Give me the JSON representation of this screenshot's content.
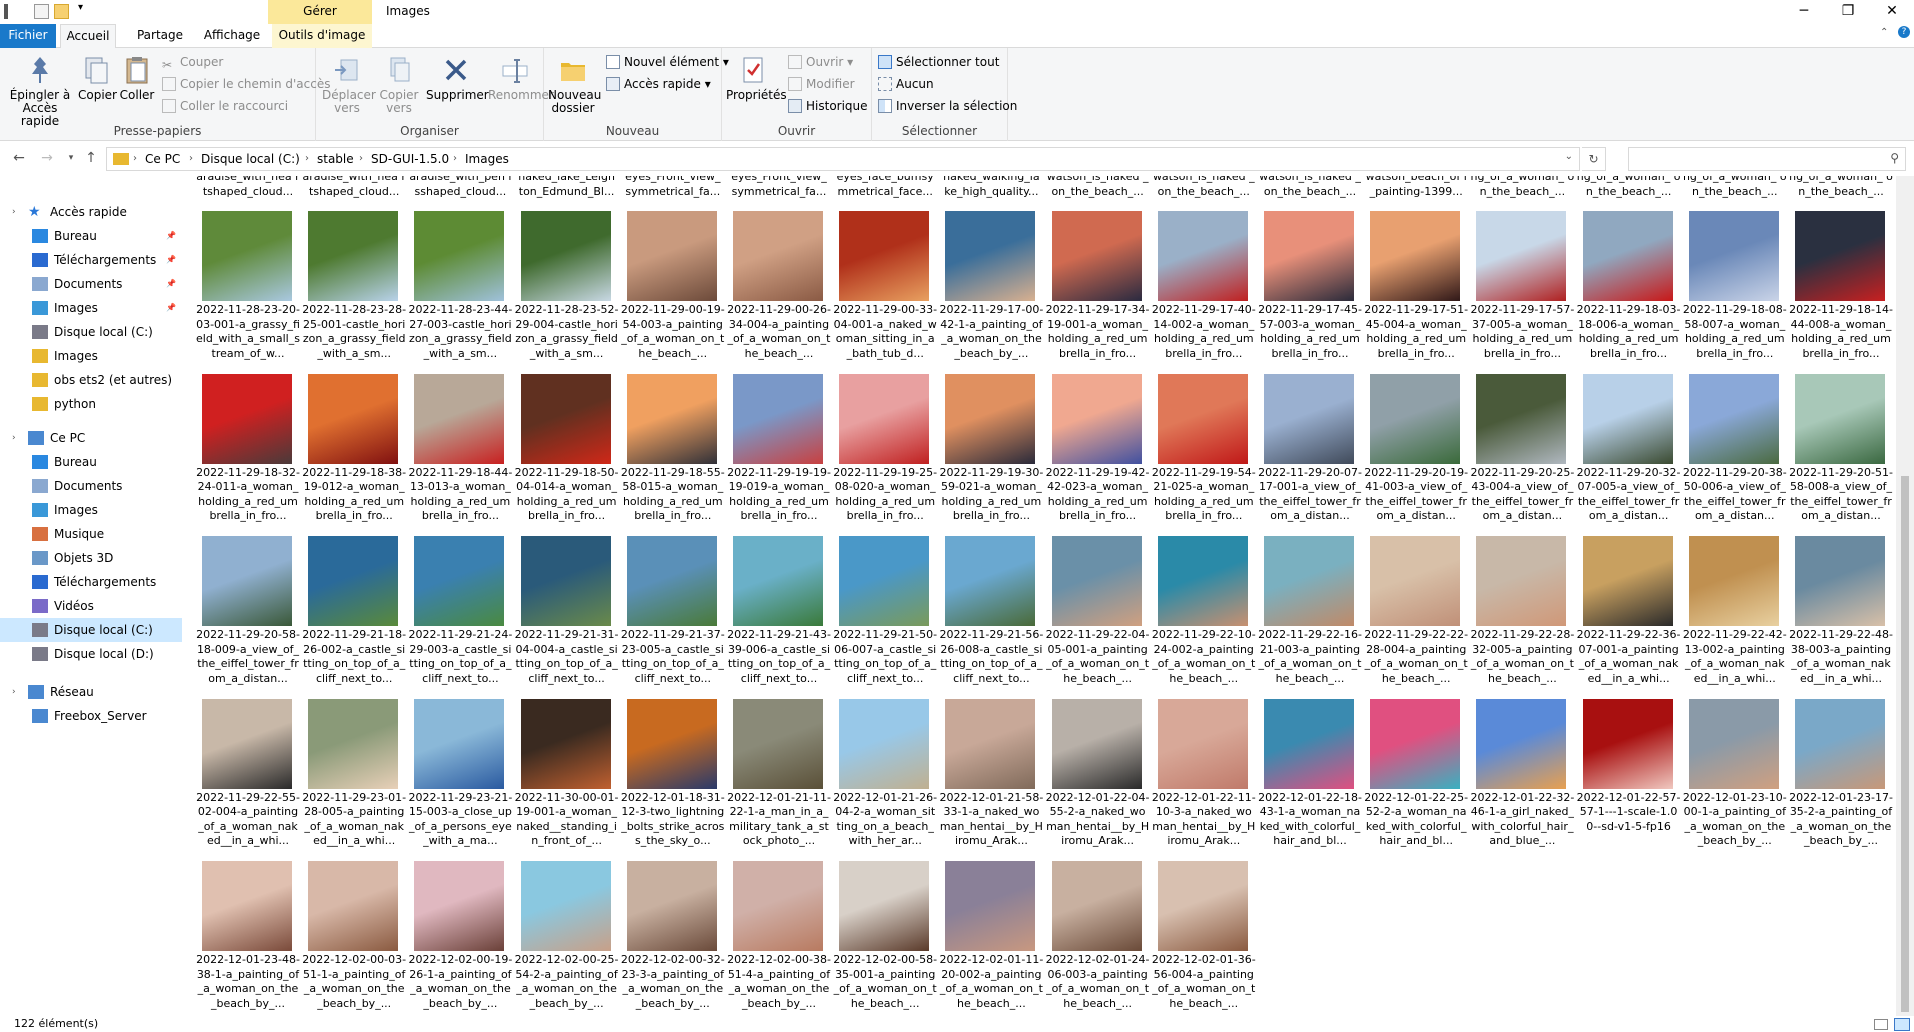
{
  "window": {
    "contextual_tab": "Gérer",
    "title": "Images"
  },
  "tabs": {
    "file": "Fichier",
    "home": "Accueil",
    "share": "Partage",
    "view": "Affichage",
    "image_tools": "Outils d'image"
  },
  "ribbon": {
    "clipboard": {
      "label": "Presse-papiers",
      "pin": "Épingler à Accès rapide",
      "copy": "Copier",
      "paste": "Coller",
      "cut": "Couper",
      "copy_path": "Copier le chemin d'accès",
      "paste_shortcut": "Coller le raccourci"
    },
    "organize": {
      "label": "Organiser",
      "move": "Déplacer vers",
      "copyto": "Copier vers",
      "delete": "Supprimer",
      "rename": "Renommer"
    },
    "new": {
      "label": "Nouveau",
      "new_folder": "Nouveau dossier",
      "new_item": "Nouvel élément",
      "quick_access": "Accès rapide"
    },
    "open": {
      "label": "Ouvrir",
      "properties": "Propriétés",
      "open": "Ouvrir",
      "edit": "Modifier",
      "history": "Historique"
    },
    "select": {
      "label": "Sélectionner",
      "select_all": "Sélectionner tout",
      "none": "Aucun",
      "invert": "Inverser la sélection"
    }
  },
  "breadcrumb": [
    "Ce PC",
    "Disque local (C:)",
    "stable",
    "SD-GUI-1.5.0",
    "Images"
  ],
  "nav": {
    "quick_access": "Accès rapide",
    "quick_items": [
      "Bureau",
      "Téléchargements",
      "Documents",
      "Images",
      "Disque local (C:)",
      "Images",
      "obs ets2 (et autres)",
      "python"
    ],
    "this_pc": "Ce PC",
    "pc_items": [
      "Bureau",
      "Documents",
      "Images",
      "Musique",
      "Objets 3D",
      "Téléchargements",
      "Vidéos",
      "Disque local (C:)",
      "Disque local (D:)"
    ],
    "network": "Réseau",
    "network_items": [
      "Freebox_Server"
    ]
  },
  "top_partial": [
    "aradise_with_nea rtshaped_cloud...",
    "aradise_with_nea rtshaped_cloud...",
    "aradise_with_pen isshaped_cloud...",
    "naked_lake_Leigh ton_Edmund_Bl...",
    "eyes_Front_view_ symmetrical_fa...",
    "eyes_Front_view_ symmetrical_fa...",
    "eyes_face_bumsy mmetrical_face...",
    "naked_walking_la ke_high_quality...",
    "watson_is_naked _on_the_beach_...",
    "watson_is_naked _on_the_beach_...",
    "watson_is_naked _on_the_beach_...",
    "watson_beach_of l_painting-1399...",
    "ng_of_a_woman_ on_the_beach_...",
    "ng_of_a_woman_ on_the_beach_...",
    "ng_of_a_woman_ on_the_beach_...",
    "ng_of_a_woman_ on_the_beach_..."
  ],
  "files": [
    [
      "2022-11-28-23-20-03-001-a_grassy_field_with_a_small_stream_of_w...",
      "2022-11-28-23-28-25-001-castle_horizon_a_grassy_field_with_a_sm...",
      "2022-11-28-23-44-27-003-castle_horizon_a_grassy_field_with_a_sm...",
      "2022-11-28-23-52-29-004-castle_horizon_a_grassy_field_with_a_sm...",
      "2022-11-29-00-19-54-003-a_painting_of_a_woman_on_the_beach_...",
      "2022-11-29-00-26-34-004-a_painting_of_a_woman_on_the_beach_...",
      "2022-11-29-00-33-04-001-a_naked_woman_sitting_in_a_bath_tub_d...",
      "2022-11-29-17-00-42-1-a_painting_of_a_woman_on_the_beach_by_...",
      "2022-11-29-17-34-19-001-a_woman_holding_a_red_umbrella_in_fro...",
      "2022-11-29-17-40-14-002-a_woman_holding_a_red_umbrella_in_fro...",
      "2022-11-29-17-45-57-003-a_woman_holding_a_red_umbrella_in_fro...",
      "2022-11-29-17-51-45-004-a_woman_holding_a_red_umbrella_in_fro...",
      "2022-11-29-17-57-37-005-a_woman_holding_a_red_umbrella_in_fro...",
      "2022-11-29-18-03-18-006-a_woman_holding_a_red_umbrella_in_fro...",
      "2022-11-29-18-08-58-007-a_woman_holding_a_red_umbrella_in_fro...",
      "2022-11-29-18-14-44-008-a_woman_holding_a_red_umbrella_in_fro..."
    ],
    [
      "2022-11-29-18-32-24-011-a_woman_holding_a_red_umbrella_in_fro...",
      "2022-11-29-18-38-19-012-a_woman_holding_a_red_umbrella_in_fro...",
      "2022-11-29-18-44-13-013-a_woman_holding_a_red_umbrella_in_fro...",
      "2022-11-29-18-50-04-014-a_woman_holding_a_red_umbrella_in_fro...",
      "2022-11-29-18-55-58-015-a_woman_holding_a_red_umbrella_in_fro...",
      "2022-11-29-19-19-19-019-a_woman_holding_a_red_umbrella_in_fro...",
      "2022-11-29-19-25-08-020-a_woman_holding_a_red_umbrella_in_fro...",
      "2022-11-29-19-30-59-021-a_woman_holding_a_red_umbrella_in_fro...",
      "2022-11-29-19-42-42-023-a_woman_holding_a_red_umbrella_in_fro...",
      "2022-11-29-19-54-21-025-a_woman_holding_a_red_umbrella_in_fro...",
      "2022-11-29-20-07-17-001-a_view_of_the_eiffel_tower_from_a_distan...",
      "2022-11-29-20-19-41-003-a_view_of_the_eiffel_tower_from_a_distan...",
      "2022-11-29-20-25-43-004-a_view_of_the_eiffel_tower_from_a_distan...",
      "2022-11-29-20-32-07-005-a_view_of_the_eiffel_tower_from_a_distan...",
      "2022-11-29-20-38-50-006-a_view_of_the_eiffel_tower_from_a_distan...",
      "2022-11-29-20-51-58-008-a_view_of_the_eiffel_tower_from_a_distan..."
    ],
    [
      "2022-11-29-20-58-18-009-a_view_of_the_eiffel_tower_from_a_distan...",
      "2022-11-29-21-18-26-002-a_castle_sitting_on_top_of_a_cliff_next_to...",
      "2022-11-29-21-24-29-003-a_castle_sitting_on_top_of_a_cliff_next_to...",
      "2022-11-29-21-31-04-004-a_castle_sitting_on_top_of_a_cliff_next_to...",
      "2022-11-29-21-37-23-005-a_castle_sitting_on_top_of_a_cliff_next_to...",
      "2022-11-29-21-43-39-006-a_castle_sitting_on_top_of_a_cliff_next_to...",
      "2022-11-29-21-50-06-007-a_castle_sitting_on_top_of_a_cliff_next_to...",
      "2022-11-29-21-56-26-008-a_castle_sitting_on_top_of_a_cliff_next_to...",
      "2022-11-29-22-04-05-001-a_painting_of_a_woman_on_the_beach_...",
      "2022-11-29-22-10-24-002-a_painting_of_a_woman_on_the_beach_...",
      "2022-11-29-22-16-21-003-a_painting_of_a_woman_on_the_beach_...",
      "2022-11-29-22-22-28-004-a_painting_of_a_woman_on_the_beach_...",
      "2022-11-29-22-28-32-005-a_painting_of_a_woman_on_the_beach_...",
      "2022-11-29-22-36-07-001-a_painting_of_a_woman_naked__in_a_whi...",
      "2022-11-29-22-42-13-002-a_painting_of_a_woman_naked__in_a_whi...",
      "2022-11-29-22-48-38-003-a_painting_of_a_woman_naked__in_a_whi..."
    ],
    [
      "2022-11-29-22-55-02-004-a_painting_of_a_woman_naked__in_a_whi...",
      "2022-11-29-23-01-28-005-a_painting_of_a_woman_naked__in_a_whi...",
      "2022-11-29-23-21-15-003-a_close_up_of_a_persons_eye_with_a_ma...",
      "2022-11-30-00-01-19-001-a_woman_naked__standing_in_front_of_...",
      "2022-12-01-18-31-12-3-two_lightning_bolts_strike_across_the_sky_o...",
      "2022-12-01-21-11-22-1-a_man_in_a_military_tank_a_stock_photo_...",
      "2022-12-01-21-26-04-2-a_woman_sitting_on_a_beach_with_her_ar...",
      "2022-12-01-21-58-33-1-a_naked_woman_hentai__by_Hiromu_Arak...",
      "2022-12-01-22-04-55-2-a_naked_woman_hentai__by_Hiromu_Arak...",
      "2022-12-01-22-11-10-3-a_naked_woman_hentai__by_Hiromu_Arak...",
      "2022-12-01-22-18-43-1-a_woman_naked_with_colorful_hair_and_bl...",
      "2022-12-01-22-25-52-2-a_woman_naked_with_colorful_hair_and_bl...",
      "2022-12-01-22-32-46-1-a_girl_naked_with_colorful_hair_and_blue_...",
      "2022-12-01-22-57-57-1---1-scale-1.00--sd-v1-5-fp16",
      "2022-12-01-23-10-00-1-a_painting_of_a_woman_on_the_beach_by_...",
      "2022-12-01-23-17-35-2-a_painting_of_a_woman_on_the_beach_by_..."
    ],
    [
      "2022-12-01-23-48-38-1-a_painting_of_a_woman_on_the_beach_by_...",
      "2022-12-02-00-03-51-1-a_painting_of_a_woman_on_the_beach_by_...",
      "2022-12-02-00-19-26-1-a_painting_of_a_woman_on_the_beach_by_...",
      "2022-12-02-00-25-54-2-a_painting_of_a_woman_on_the_beach_by_...",
      "2022-12-02-00-32-23-3-a_painting_of_a_woman_on_the_beach_by_...",
      "2022-12-02-00-38-51-4-a_painting_of_a_woman_on_the_beach_by_...",
      "2022-12-02-00-58-35-001-a_painting_of_a_woman_on_the_beach_...",
      "2022-12-02-01-11-20-002-a_painting_of_a_woman_on_the_beach_...",
      "2022-12-02-01-24-06-003-a_painting_of_a_woman_on_the_beach_...",
      "2022-12-02-01-36-56-004-a_painting_of_a_woman_on_the_beach_..."
    ]
  ],
  "thumb_colors": [
    [
      [
        "#5f8a3a",
        "#a9c8e0"
      ],
      [
        "#4e7a30",
        "#b8d2ea"
      ],
      [
        "#5d8b34",
        "#9fc1db"
      ],
      [
        "#3f6a2d",
        "#c8d8e4"
      ],
      [
        "#c99a7e",
        "#6c4a3a"
      ],
      [
        "#d0a084",
        "#8a5a44"
      ],
      [
        "#b0301a",
        "#e8a060"
      ],
      [
        "#3a6e9a",
        "#d8b090"
      ],
      [
        "#d06a50",
        "#2a2a40"
      ],
      [
        "#9ab0c8",
        "#c02020"
      ],
      [
        "#e8907a",
        "#2a2a3a"
      ],
      [
        "#e8a070",
        "#301818"
      ],
      [
        "#c8d8e8",
        "#b02020"
      ],
      [
        "#90a8c0",
        "#c81818"
      ],
      [
        "#6a88b8",
        "#cad4e8"
      ],
      [
        "#2a3040",
        "#c82020"
      ]
    ],
    [
      [
        "#d02020",
        "#4a3a3a"
      ],
      [
        "#e07030",
        "#801010"
      ],
      [
        "#b8a898",
        "#c82020"
      ],
      [
        "#603020",
        "#d02818"
      ],
      [
        "#f0a060",
        "#303038"
      ],
      [
        "#7a98c8",
        "#c84040"
      ],
      [
        "#e8a0a0",
        "#c02020"
      ],
      [
        "#e09060",
        "#2a2a3a"
      ],
      [
        "#f0a890",
        "#4050a0"
      ],
      [
        "#e07858",
        "#c01818"
      ],
      [
        "#9ab0d0",
        "#404a5a"
      ],
      [
        "#90a0a8",
        "#3a6a3a"
      ],
      [
        "#4a5a3a",
        "#b0b8c0"
      ],
      [
        "#b8d0e8",
        "#3a4a30"
      ],
      [
        "#8aa8d8",
        "#4a6a40"
      ],
      [
        "#a8c8b8",
        "#3a6840"
      ]
    ],
    [
      [
        "#90b0d0",
        "#3a5838"
      ],
      [
        "#2a6a9a",
        "#5a8a3a"
      ],
      [
        "#3a80b0",
        "#4a8a40"
      ],
      [
        "#2a5a7a",
        "#6a8a4a"
      ],
      [
        "#5a90b8",
        "#4a7a38"
      ],
      [
        "#6ab0c8",
        "#3a7a3a"
      ],
      [
        "#4a98c8",
        "#7a9a5a"
      ],
      [
        "#6aa8d0",
        "#4a6a38"
      ],
      [
        "#6a90a8",
        "#d0a080"
      ],
      [
        "#2a8aa8",
        "#c89070"
      ],
      [
        "#7ab0c0",
        "#c08a68"
      ],
      [
        "#d8c0a8",
        "#c09078"
      ],
      [
        "#c8b8a8",
        "#d09878"
      ],
      [
        "#c8a060",
        "#2a2a2a"
      ],
      [
        "#c09050",
        "#e8d0a0"
      ],
      [
        "#6a8aa0",
        "#d8c0a8"
      ]
    ],
    [
      [
        "#c8b8a8",
        "#2a2a2a"
      ],
      [
        "#8a9a78",
        "#e8d0b8"
      ],
      [
        "#8ab8d8",
        "#2a5aa0"
      ],
      [
        "#3a2a20",
        "#c06030"
      ],
      [
        "#c86a20",
        "#2a3a6a"
      ],
      [
        "#8a8a78",
        "#5a5038"
      ],
      [
        "#98c8e8",
        "#c0b090"
      ],
      [
        "#c8a898",
        "#806a5a"
      ],
      [
        "#b8b0a8",
        "#2a2a2a"
      ],
      [
        "#d8a898",
        "#c07a6a"
      ],
      [
        "#3a8ab0",
        "#e05080"
      ],
      [
        "#e05080",
        "#3ab0c0"
      ],
      [
        "#5a8ad8",
        "#e8a050"
      ],
      [
        "#a81010",
        "#f0c8c0"
      ],
      [
        "#8a9aa8",
        "#d0a080"
      ],
      [
        "#7aa8c8",
        "#c89878"
      ]
    ],
    [
      [
        "#e0c0b0",
        "#7a4a3a"
      ],
      [
        "#d8b8a8",
        "#8a5a40"
      ],
      [
        "#e0b8c0",
        "#6a4038"
      ],
      [
        "#8ac8e0",
        "#c8a088"
      ],
      [
        "#c8b0a0",
        "#6a4a3a"
      ],
      [
        "#d0b0a8",
        "#b87a60"
      ],
      [
        "#d8d0c8",
        "#5a3a2a"
      ],
      [
        "#8a8098",
        "#c89880"
      ],
      [
        "#c8b0a0",
        "#6a4a38"
      ],
      [
        "#d8c0b0",
        "#8a5a40"
      ]
    ]
  ],
  "status": {
    "count": "122 élément(s)"
  }
}
